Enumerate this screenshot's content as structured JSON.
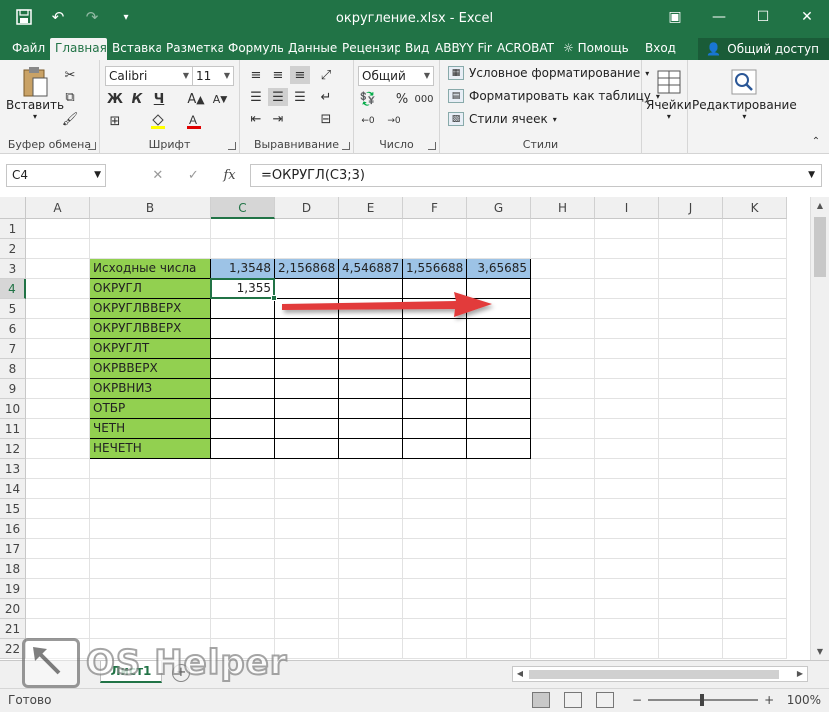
{
  "window": {
    "title": "округление.xlsx - Excel",
    "controls": {
      "restore": "▣",
      "minimize": "—",
      "maximize": "☐",
      "close": "✕"
    }
  },
  "qat": {
    "save_icon": "save-icon",
    "undo_icon": "undo-icon",
    "redo_icon": "redo-icon"
  },
  "tabs": [
    {
      "label": "Файл",
      "active": false
    },
    {
      "label": "Главная",
      "active": true
    },
    {
      "label": "Вставка",
      "active": false
    },
    {
      "label": "Разметка с",
      "active": false
    },
    {
      "label": "Формулы",
      "active": false
    },
    {
      "label": "Данные",
      "active": false
    },
    {
      "label": "Рецензиро",
      "active": false
    },
    {
      "label": "Вид",
      "active": false
    },
    {
      "label": "ABBYY Fin",
      "active": false
    },
    {
      "label": "ACROBAT",
      "active": false
    },
    {
      "label": "Помощь",
      "active": false
    },
    {
      "label": "Вход",
      "active": false
    }
  ],
  "share_label": "Общий доступ",
  "ribbon": {
    "clipboard": {
      "label": "Буфер обмена",
      "paste": "Вставить"
    },
    "font": {
      "label": "Шрифт",
      "name": "Calibri",
      "size": "11",
      "bold": "Ж",
      "italic": "К",
      "underline": "Ч"
    },
    "alignment": {
      "label": "Выравнивание"
    },
    "number": {
      "label": "Число",
      "format": "Общий",
      "percent": "%",
      "thousands": "000"
    },
    "styles": {
      "label": "Стили",
      "conditional": "Условное форматирование",
      "as_table": "Форматировать как таблицу",
      "cell_styles": "Стили ячеек"
    },
    "cells": {
      "label": "Ячейки"
    },
    "editing": {
      "label": "Редактирование"
    }
  },
  "formula_bar": {
    "name_box": "C4",
    "cancel": "✕",
    "enter": "✓",
    "fx": "fx",
    "formula": "=ОКРУГЛ(C3;3)"
  },
  "sheet": {
    "columns": [
      "A",
      "B",
      "C",
      "D",
      "E",
      "F",
      "G",
      "H",
      "I",
      "J",
      "K"
    ],
    "rows": [
      "1",
      "2",
      "3",
      "4",
      "5",
      "6",
      "7",
      "8",
      "9",
      "10",
      "11",
      "12",
      "13",
      "14",
      "15",
      "16",
      "17",
      "18",
      "19",
      "20",
      "21",
      "22"
    ],
    "cells": {
      "B3": "Исходные числа",
      "C3": "1,3548",
      "D3": "2,156868",
      "E3": "4,546887",
      "F3": "1,556688",
      "G3": "3,65685",
      "B4": "ОКРУГЛ",
      "C4": "1,355",
      "B5": "ОКРУГЛВВЕРХ",
      "B6": "ОКРУГЛВВЕРХ",
      "B7": "ОКРУГЛТ",
      "B8": "ОКРВВЕРХ",
      "B9": "ОКРВНИЗ",
      "B10": "ОТБР",
      "B11": "ЧЕТН",
      "B12": "НЕЧЕТН"
    },
    "selected_cell": "C4"
  },
  "sheet_tabs": [
    {
      "label": "Лист1",
      "active": true
    }
  ],
  "status": {
    "text": "Готово",
    "zoom": "100%"
  },
  "watermark": {
    "text": "OS Helper"
  },
  "colors": {
    "excel_green": "#217346",
    "label_fill": "#92d050",
    "value_fill": "#9dc3e6",
    "arrow": "#e23b3b"
  }
}
